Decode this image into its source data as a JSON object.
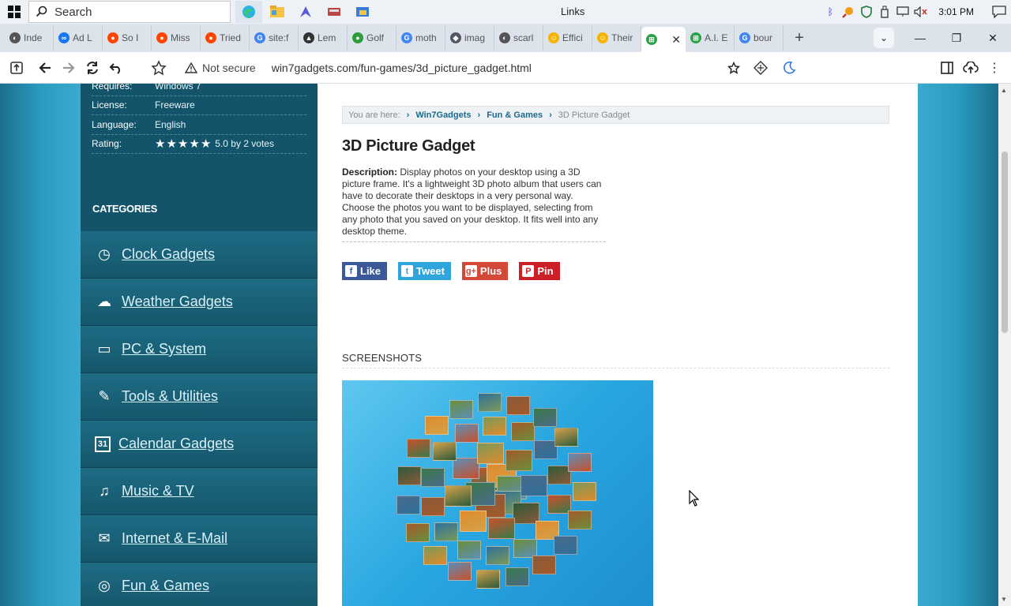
{
  "taskbar": {
    "search_placeholder": "Search",
    "window_title": "Links",
    "time": "3:01 PM"
  },
  "tabs": [
    {
      "label": "Inde",
      "color": "#555",
      "glyph": "◐"
    },
    {
      "label": "Ad L",
      "color": "#1877f2",
      "glyph": "∞"
    },
    {
      "label": "So I",
      "color": "#ff4500",
      "glyph": "●"
    },
    {
      "label": "Miss",
      "color": "#ff4500",
      "glyph": "●"
    },
    {
      "label": "Tried",
      "color": "#ff4500",
      "glyph": "●"
    },
    {
      "label": "site:f",
      "color": "#4285f4",
      "glyph": "G"
    },
    {
      "label": "Lem",
      "color": "#333",
      "glyph": "▲"
    },
    {
      "label": "Golf",
      "color": "#2e9b3c",
      "glyph": "●"
    },
    {
      "label": "moth",
      "color": "#4285f4",
      "glyph": "G"
    },
    {
      "label": "imag",
      "color": "#556",
      "glyph": "◆"
    },
    {
      "label": "scarl",
      "color": "#555",
      "glyph": "◐"
    },
    {
      "label": "Effici",
      "color": "#f4b400",
      "glyph": "☺"
    },
    {
      "label": "Their",
      "color": "#f4b400",
      "glyph": "☺"
    },
    {
      "label": "",
      "color": "#2aa34a",
      "glyph": "⊞",
      "active": true
    },
    {
      "label": "A.I. E",
      "color": "#2aa34a",
      "glyph": "⊞"
    },
    {
      "label": "bour",
      "color": "#4285f4",
      "glyph": "G"
    }
  ],
  "toolbar": {
    "security_label": "Not secure",
    "url": "win7gadgets.com/fun-games/3d_picture_gadget.html"
  },
  "sidebar": {
    "specs": [
      {
        "key": "Requires:",
        "value": "Windows 7"
      },
      {
        "key": "License:",
        "value": "Freeware"
      },
      {
        "key": "Language:",
        "value": "English"
      }
    ],
    "rating_key": "Rating:",
    "rating_text": "5.0 by 2 votes",
    "rating_stars": 5,
    "categories_title": "CATEGORIES",
    "categories": [
      {
        "label": "Clock Gadgets",
        "icon": "clock-icon",
        "glyph": "◷"
      },
      {
        "label": "Weather Gadgets",
        "icon": "weather-icon",
        "glyph": "☁"
      },
      {
        "label": "PC & System",
        "icon": "monitor-icon",
        "glyph": "▭"
      },
      {
        "label": "Tools & Utilities",
        "icon": "wrench-icon",
        "glyph": "✎"
      },
      {
        "label": "Calendar Gadgets",
        "icon": "calendar-icon",
        "glyph": "31"
      },
      {
        "label": "Music & TV",
        "icon": "music-icon",
        "glyph": "♫"
      },
      {
        "label": "Internet & E-Mail",
        "icon": "mail-icon",
        "glyph": "✉"
      },
      {
        "label": "Fun & Games",
        "icon": "gamepad-icon",
        "glyph": "◎"
      }
    ]
  },
  "content": {
    "breadcrumb": {
      "prefix": "You are here:",
      "home": "Win7Gadgets",
      "section": "Fun & Games",
      "current": "3D Picture Gadget"
    },
    "title": "3D Picture Gadget",
    "description_label": "Description:",
    "description": "Display photos on your desktop using a 3D picture frame. It's a lightweight 3D photo album that users can have to decorate their desktops in a very personal way. Choose the photos you want to be displayed, selecting from any photo that you saved on your desktop. It fits well into any desktop theme.",
    "social": [
      {
        "label": "Like",
        "color": "#3b5998",
        "glyph": "f"
      },
      {
        "label": "Tweet",
        "color": "#2fa5dd",
        "glyph": "t"
      },
      {
        "label": "Plus",
        "color": "#d34836",
        "glyph": "g+"
      },
      {
        "label": "Pin",
        "color": "#cb2027",
        "glyph": "P"
      }
    ],
    "screenshots_heading": "SCREENSHOTS"
  }
}
